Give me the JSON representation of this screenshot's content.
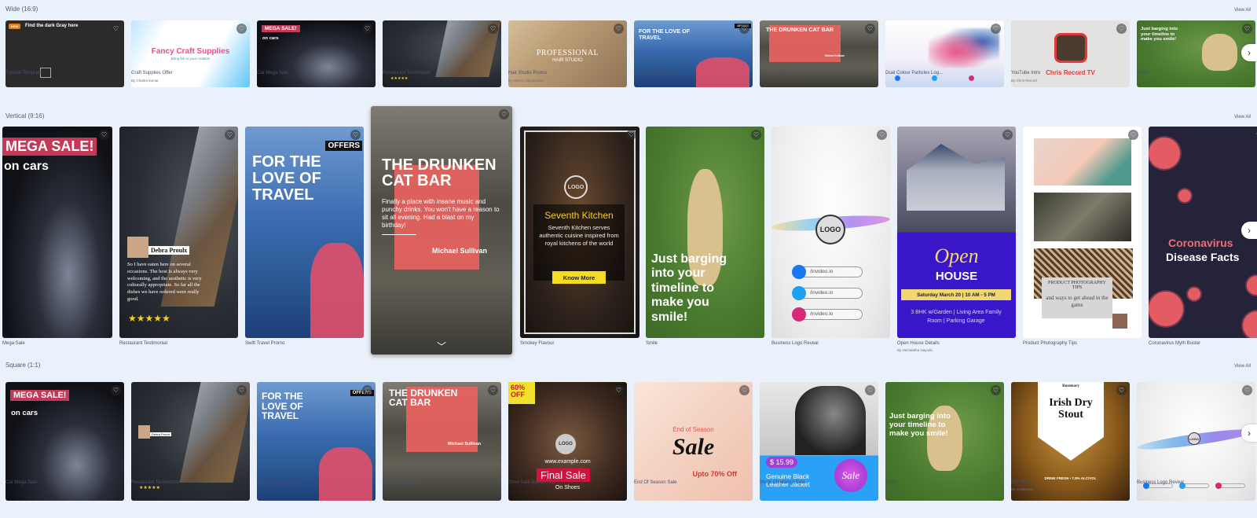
{
  "sections": [
    {
      "title": "Wide (16:9)",
      "view_all": "View All",
      "cards": [
        {
          "name": "Tutorial Template",
          "author": "",
          "overlay": "Find the dark Gray here",
          "badge": "NEW",
          "bg": "#2c2c2c"
        },
        {
          "name": "Craft Supplies Offer",
          "author": "By Chaitra kumar",
          "overlay": "Fancy Craft Supplies",
          "sub": "Bring life to your creation",
          "bg": "#e8f6ff"
        },
        {
          "name": "Car Mega Sale",
          "author": "",
          "overlay": "MEGA SALE!",
          "sub": "on cars",
          "bg": "#15161c"
        },
        {
          "name": "Restaurant Testimonial",
          "author": "",
          "overlay": "★★★★★",
          "bg": "#1d2127"
        },
        {
          "name": "Hair Studio Promo",
          "author": "By Marcin Jakubowski",
          "overlay": "PROFESSIONAL",
          "sub": "HAIR STUDIO",
          "bg": "#b79a77"
        },
        {
          "name": "Swift Travel Promo",
          "author": "",
          "overlay": "FOR THE LOVE OF TRAVEL",
          "badge": "OFFERS",
          "bg": "#2a5fa5"
        },
        {
          "name": "Bistro Testimonial",
          "author": "",
          "overlay": "THE DRUNKEN CAT BAR",
          "sub": "Michael Sullivan",
          "bg": "#3b4036"
        },
        {
          "name": "Dual Colour Particles Log...",
          "author": "",
          "overlay": "",
          "bg": "#f3f0f8"
        },
        {
          "name": "YouTube Intro",
          "author": "By Chris Record",
          "overlay": "Chris Record TV",
          "bg": "#e6e4e2"
        },
        {
          "name": "Smile",
          "author": "",
          "overlay": "Just barging into your timeline to make you smile!",
          "bg": "#4e7d33"
        }
      ]
    },
    {
      "title": "Vertical (9:16)",
      "view_all": "View All",
      "cards": [
        {
          "name": "Mega Sale",
          "author": "",
          "overlay": "MEGA SALE!",
          "sub": "on cars",
          "bg": "#15161c"
        },
        {
          "name": "Restaurant Testimonial",
          "author": "",
          "overlay": "Debra Proulx",
          "sub": "So I have eaten here on several occasions. The host is always very welcoming, and the aesthetic is very culturally appropriate. So far all the dishes we have ordered were really good.",
          "stars": "★★★★★",
          "bg": "#22262c"
        },
        {
          "name": "Swift Travel Promo",
          "author": "",
          "overlay": "FOR THE LOVE OF TRAVEL",
          "badge": "OFFERS",
          "bg": "#3f74b3"
        },
        {
          "name": "",
          "author": "",
          "overlay": "THE DRUNKEN CAT BAR",
          "sub": "Finally a place with insane music and punchy drinks. You won't have a reason to sit all evening. Had a blast on my birthday!",
          "sign": "Michael Sullivan",
          "bg": "#5b5a55"
        },
        {
          "name": "Smokey Flavour",
          "author": "",
          "overlay": "Seventh Kitchen",
          "sub": "Seventh Kitchen serves authentic cuisine inspired from royal kitchens of the world",
          "cta": "Know More",
          "logo": "LOGO",
          "bg": "#2a211c"
        },
        {
          "name": "Smile",
          "author": "",
          "overlay": "Just barging into your timeline to make you smile!",
          "bg": "#4f7f35"
        },
        {
          "name": "Business Logo Reveal",
          "author": "",
          "logo": "LOGO",
          "links": [
            "/invideo.io",
            "/invideo.io",
            "/invideo.io"
          ],
          "bg": "#efefef"
        },
        {
          "name": "Open House Details",
          "author": "By Hemalatha Nayudu",
          "overlay": "Open",
          "sub": "HOUSE",
          "date": "Saturday March 20 | 10 AM - 5 PM",
          "details": "3 BHK w/Garden | Living Area Family Room | Parking Garage",
          "bg": "#3a16c9"
        },
        {
          "name": "Product Photography Tips",
          "author": "",
          "overlay": "PRODUCT PHOTOGRAPHY TIPS",
          "sub": "and ways to get ahead in the game",
          "bg": "#ffffff"
        },
        {
          "name": "Coronavirus Myth Buster",
          "author": "",
          "overlay": "Coronavirus",
          "sub": "Disease Facts",
          "bg": "#24233a"
        }
      ]
    },
    {
      "title": "Square (1:1)",
      "view_all": "View All",
      "cards": [
        {
          "name": "Car Mega Sale",
          "author": "",
          "overlay": "MEGA SALE!",
          "sub": "on cars",
          "bg": "#15161c"
        },
        {
          "name": "Restaurant Testimonial",
          "author": "",
          "overlay": "Debra Proulx",
          "stars": "★★★★★",
          "bg": "#22262c"
        },
        {
          "name": "Swift Travel Promo",
          "author": "",
          "overlay": "FOR THE LOVE OF TRAVEL",
          "badge": "OFFERS",
          "bg": "#3f74b3"
        },
        {
          "name": "Bistro Testimonial",
          "author": "",
          "overlay": "THE DRUNKEN CAT BAR",
          "sub": "Michael Sullivan",
          "bg": "#5b5a55"
        },
        {
          "name": "Shoe Sale Bumper Ad",
          "author": "",
          "overlay": "Final Sale",
          "sub": "On Shoes",
          "badge": "60% OFF",
          "url": "www.example.com",
          "logo": "LOGO",
          "bg": "#3d2a20"
        },
        {
          "name": "End Of Season Sale",
          "author": "",
          "overlay": "Sale",
          "sub": "End of Season",
          "extra": "Upto 70% Off",
          "bg": "#f7dccd"
        },
        {
          "name": "Stock Clearance Sale",
          "author": "",
          "overlay": "Genuine Black Leather Jacket",
          "badge": "$ 15.99",
          "sub": "Sale",
          "bg": "#d8d8d8"
        },
        {
          "name": "Smile",
          "author": "",
          "overlay": "Just barging into your timeline to make you smile!",
          "bg": "#4f7f35"
        },
        {
          "name": "Dry Stout",
          "author": "By Anytimewp",
          "overlay": "Irish Dry Stout",
          "sub": "Rosemary",
          "extra": "DRINK FRESH • 7.5% ALC/VOL",
          "bg": "#8a5a1c"
        },
        {
          "name": "Business Logo Reveal",
          "author": "",
          "logo": "LOGO",
          "bg": "#f0f0f0"
        }
      ]
    }
  ],
  "icons": {
    "favorite": "♡",
    "next": "›",
    "expand": "﹀"
  }
}
